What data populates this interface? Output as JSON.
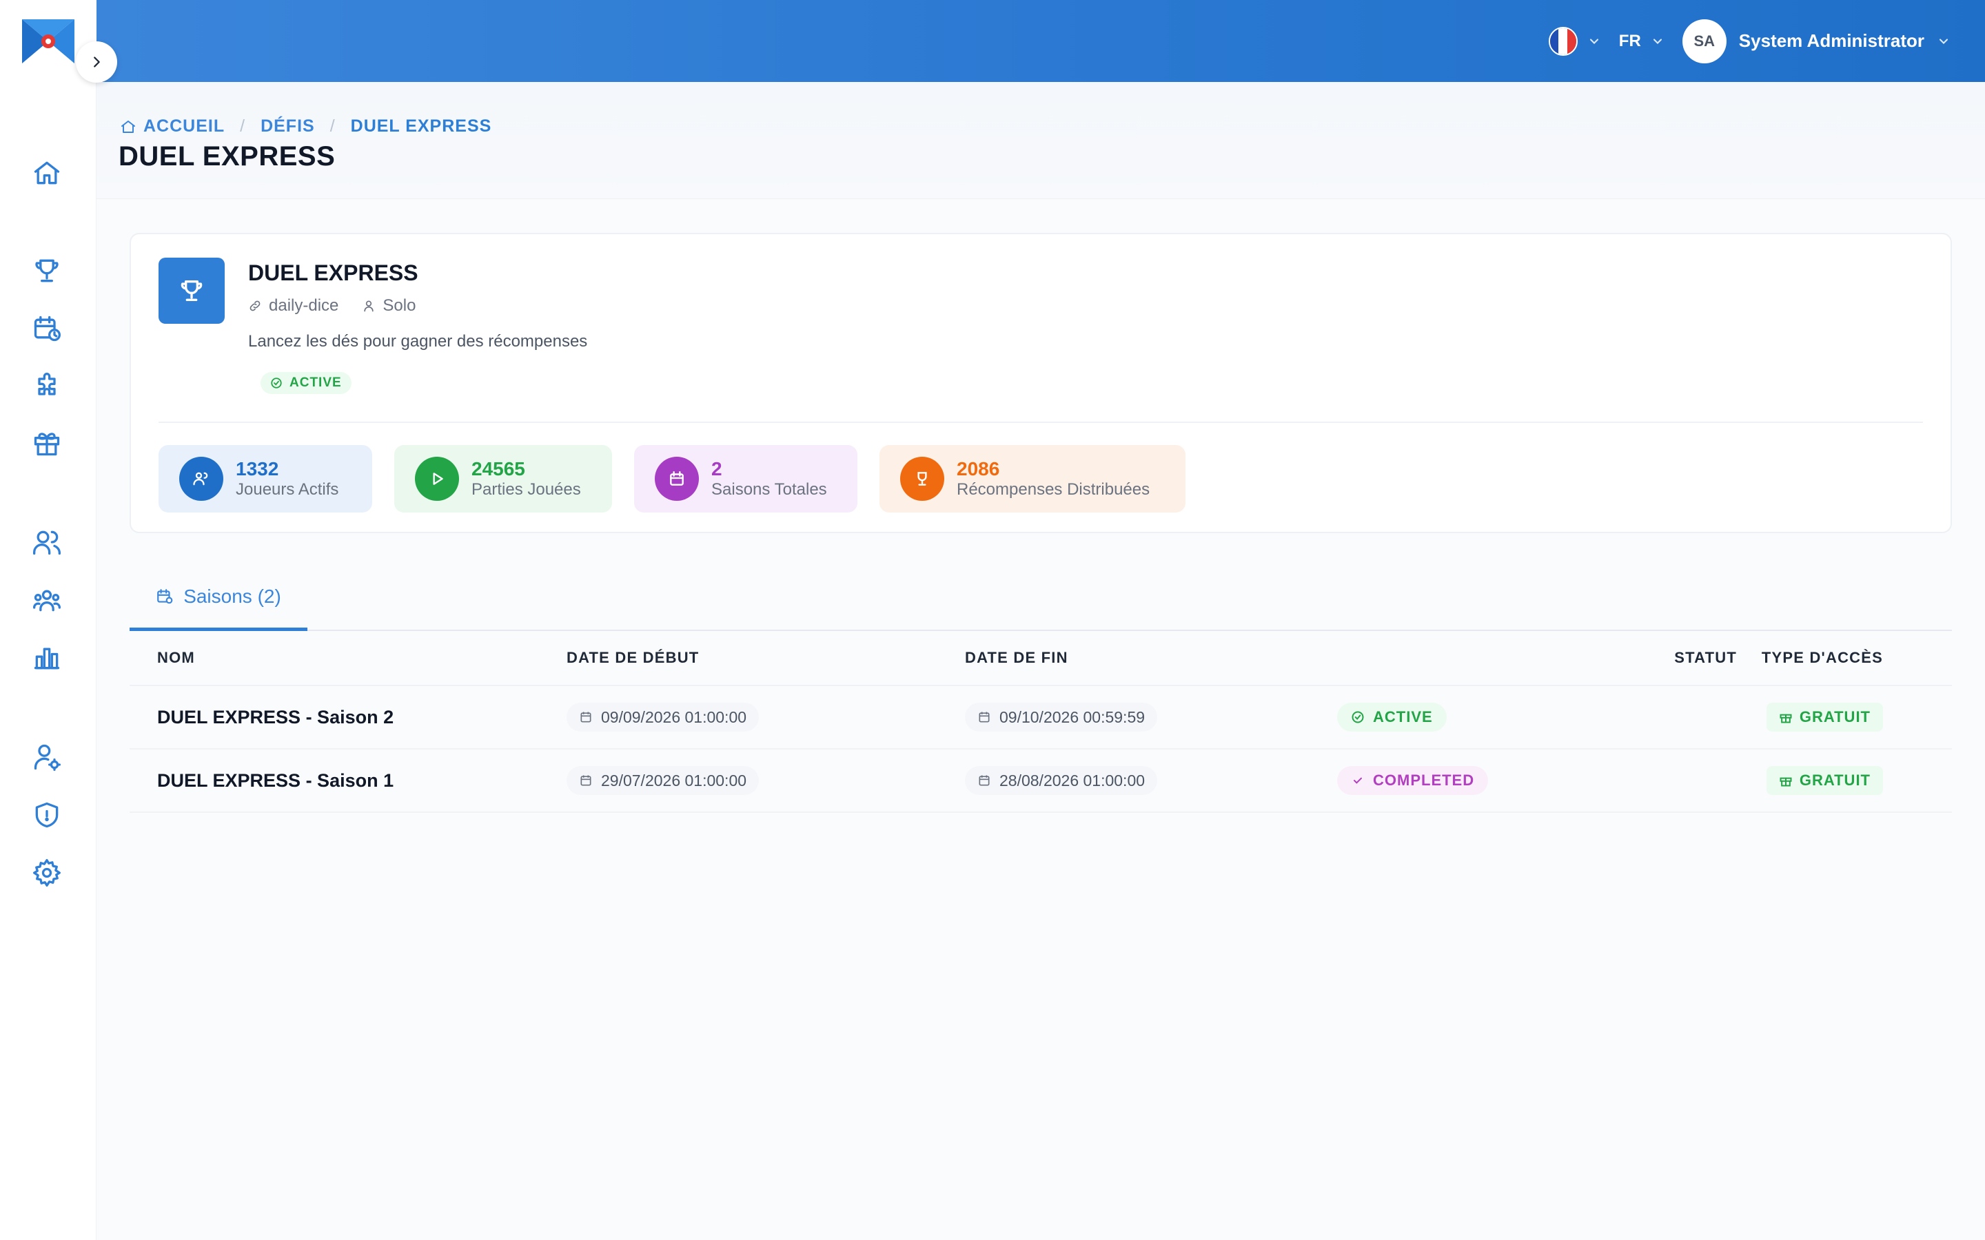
{
  "header": {
    "language": "FR",
    "user_initials": "SA",
    "user_name": "System Administrator"
  },
  "breadcrumb": {
    "home": "ACCUEIL",
    "challenges": "DÉFIS",
    "current": "DUEL EXPRESS"
  },
  "page_title": "DUEL EXPRESS",
  "game": {
    "name": "DUEL EXPRESS",
    "slug": "daily-dice",
    "mode": "Solo",
    "description": "Lancez les dés pour gagner des récompenses",
    "status": "ACTIVE"
  },
  "stats": [
    {
      "value": "1332",
      "label": "Joueurs Actifs",
      "color": "#1f6fc8",
      "bg": "#e8f1fb"
    },
    {
      "value": "24565",
      "label": "Parties Jouées",
      "color": "#22a447",
      "bg": "#eaf8ee"
    },
    {
      "value": "2",
      "label": "Saisons Totales",
      "color": "#a63cc4",
      "bg": "#f7ecfb"
    },
    {
      "value": "2086",
      "label": "Récompenses Distribuées",
      "color": "#f06b0f",
      "bg": "#fdf0e6"
    }
  ],
  "tabs": {
    "seasons": "Saisons (2)"
  },
  "table": {
    "headers": {
      "name": "NOM",
      "start": "DATE DE DÉBUT",
      "end": "DATE DE FIN",
      "status": "STATUT",
      "access": "TYPE D'ACCÈS"
    },
    "rows": [
      {
        "name": "DUEL EXPRESS - Saison 2",
        "start": "09/09/2026 01:00:00",
        "end": "09/10/2026 00:59:59",
        "status": "ACTIVE",
        "access": "GRATUIT"
      },
      {
        "name": "DUEL EXPRESS - Saison 1",
        "start": "29/07/2026 01:00:00",
        "end": "28/08/2026 01:00:00",
        "status": "COMPLETED",
        "access": "GRATUIT"
      }
    ]
  },
  "colors": {
    "primary": "#2f7fd6",
    "active_green": "#22a447",
    "completed_purple": "#b13fbf"
  }
}
